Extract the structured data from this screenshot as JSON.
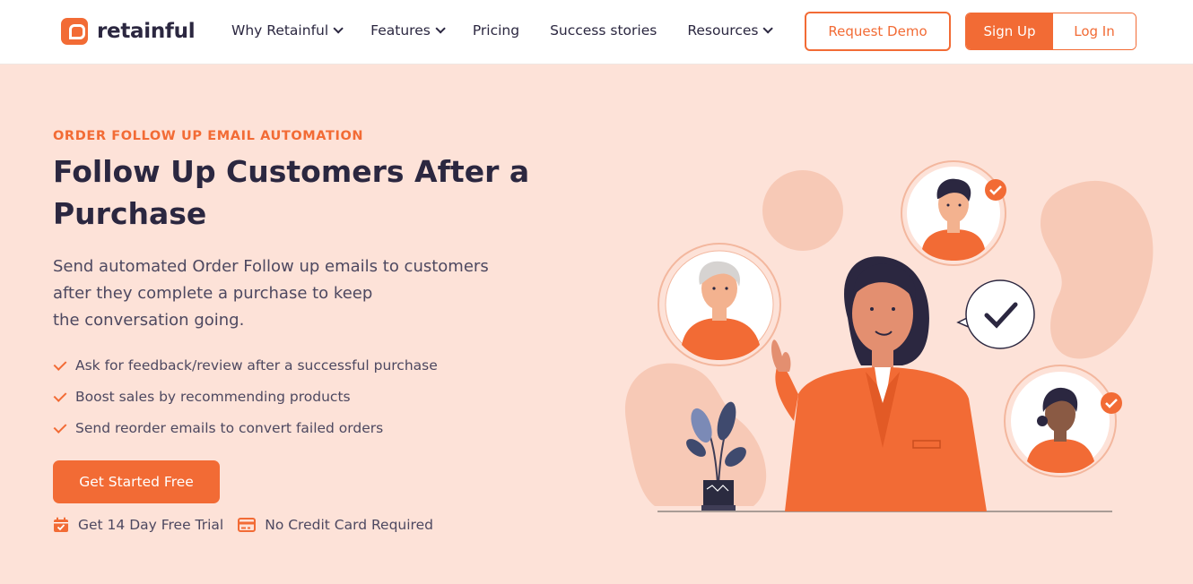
{
  "header": {
    "logo_text": "retainful",
    "nav": [
      {
        "label": "Why Retainful",
        "has_dropdown": true
      },
      {
        "label": "Features",
        "has_dropdown": true
      },
      {
        "label": "Pricing",
        "has_dropdown": false
      },
      {
        "label": "Success stories",
        "has_dropdown": false
      },
      {
        "label": "Resources",
        "has_dropdown": true
      }
    ],
    "request_demo": "Request Demo",
    "sign_up": "Sign Up",
    "log_in": "Log In"
  },
  "hero": {
    "eyebrow": "ORDER FOLLOW UP EMAIL AUTOMATION",
    "title_line1": "Follow Up Customers After a",
    "title_line2": "Purchase",
    "desc_line1": "Send automated Order Follow up emails to customers",
    "desc_line2": "after they complete a purchase to keep",
    "desc_line3": "the conversation going.",
    "features": [
      "Ask for feedback/review after a successful purchase",
      "Boost sales by recommending products",
      "Send reorder emails to convert failed orders"
    ],
    "cta": "Get Started Free",
    "perks": [
      {
        "icon": "calendar-check-icon",
        "label": "Get 14 Day Free Trial"
      },
      {
        "icon": "credit-card-icon",
        "label": "No Credit Card Required"
      }
    ]
  },
  "colors": {
    "accent": "#f26b35",
    "background": "#fde2d8",
    "text": "#2b2740"
  }
}
